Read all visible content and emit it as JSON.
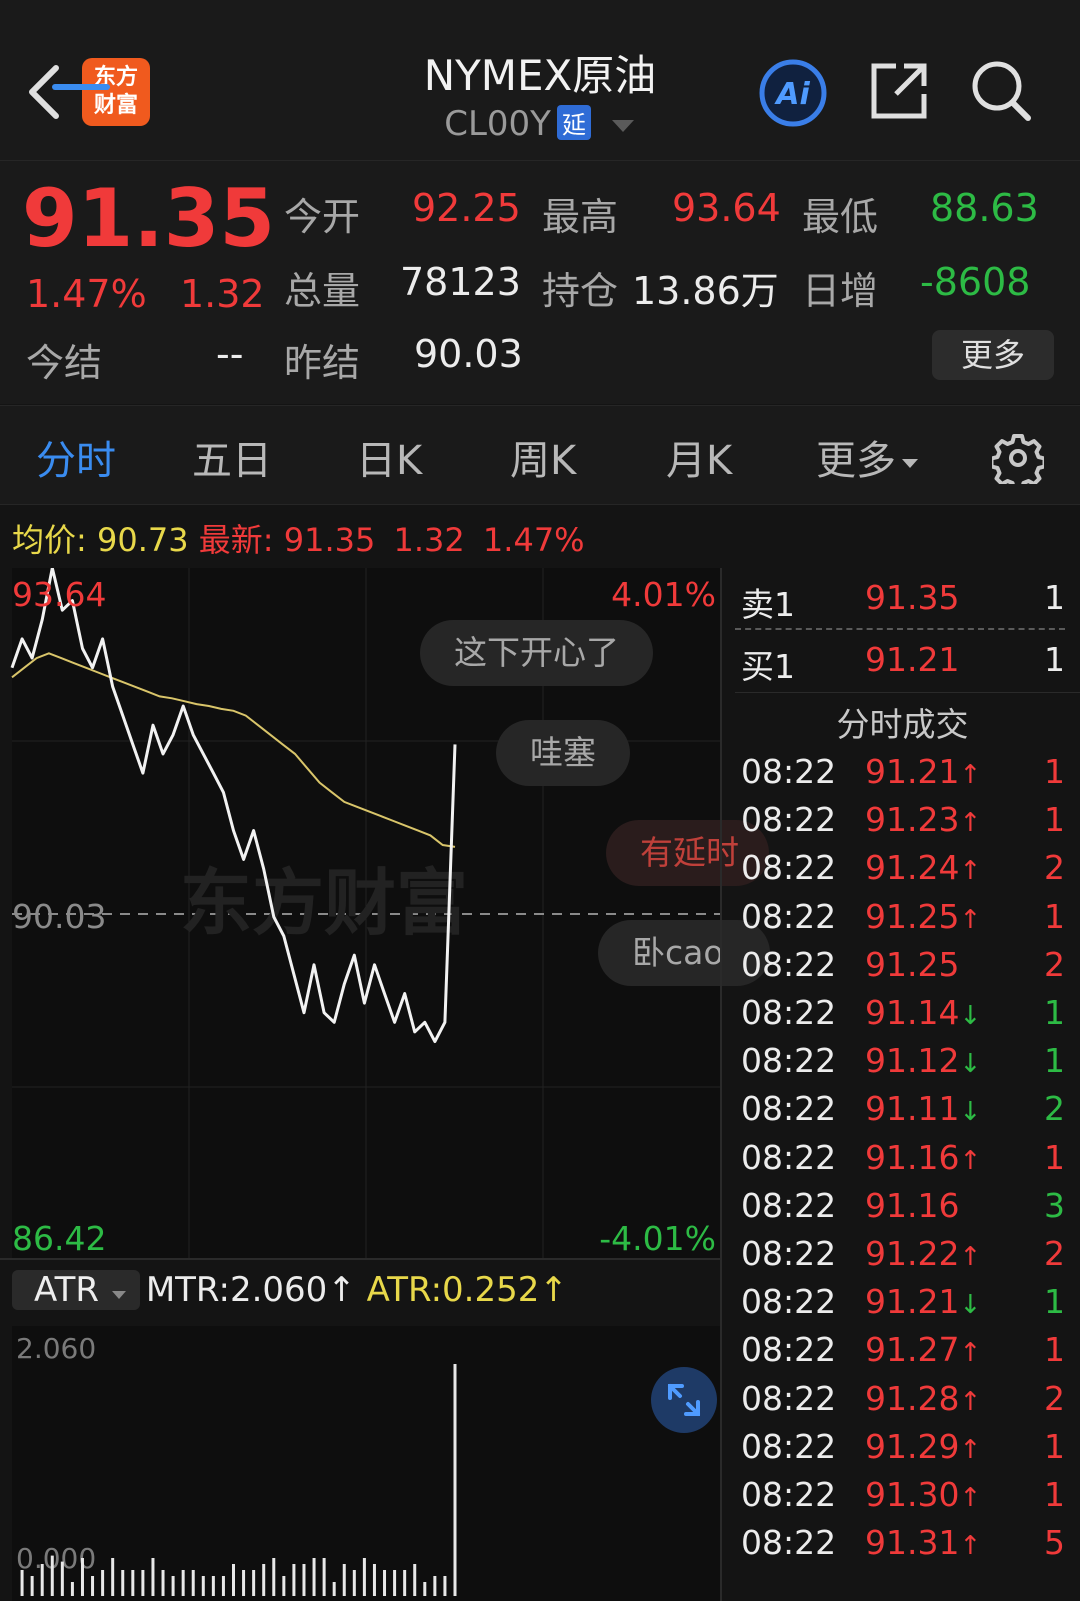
{
  "header": {
    "title": "NYMEX原油",
    "subtitle": "CL00Y",
    "delay_badge": "延",
    "logo_line1": "东方",
    "logo_line2": "财富"
  },
  "quote": {
    "price": "91.35",
    "change_pct": "1.47%",
    "change_abs": "1.32",
    "today_settle_label": "今结",
    "today_settle_value": "--",
    "open_label": "今开",
    "open_value": "92.25",
    "high_label": "最高",
    "high_value": "93.64",
    "low_label": "最低",
    "low_value": "88.63",
    "volume_label": "总量",
    "volume_value": "78123",
    "oi_label": "持仓",
    "oi_value": "13.86万",
    "daily_inc_label": "日增",
    "daily_inc_value": "-8608",
    "prev_settle_label": "昨结",
    "prev_settle_value": "90.03",
    "more_label": "更多"
  },
  "tabs": [
    "分时",
    "五日",
    "日K",
    "周K",
    "月K",
    "更多"
  ],
  "info_line": {
    "avg_label": "均价:",
    "avg_value": "90.73",
    "latest_label": "最新:",
    "latest_value": "91.35",
    "latest_change": "1.32",
    "latest_pct": "1.47%"
  },
  "chart_data": {
    "type": "line",
    "ymax_label": "93.64",
    "ymid_label": "90.03",
    "ymin_label": "86.42",
    "pct_max_label": "4.01%",
    "pct_min_label": "-4.01%",
    "ylim": [
      86.42,
      93.64
    ],
    "reference_price": 90.03,
    "price_series": [
      92.6,
      92.9,
      92.7,
      93.1,
      93.64,
      93.2,
      93.3,
      92.8,
      92.6,
      92.9,
      92.4,
      92.1,
      91.8,
      91.5,
      92.0,
      91.7,
      91.9,
      92.2,
      91.9,
      91.7,
      91.5,
      91.3,
      90.9,
      90.6,
      90.9,
      90.5,
      90.0,
      89.8,
      89.4,
      89.0,
      89.5,
      89.0,
      88.9,
      89.3,
      89.6,
      89.1,
      89.5,
      89.2,
      88.9,
      89.2,
      88.8,
      88.9,
      88.7,
      88.9,
      91.8
    ],
    "avg_series": [
      92.5,
      92.6,
      92.7,
      92.75,
      92.7,
      92.65,
      92.6,
      92.55,
      92.5,
      92.45,
      92.4,
      92.35,
      92.3,
      92.28,
      92.25,
      92.22,
      92.2,
      92.17,
      92.15,
      92.1,
      92.0,
      91.9,
      91.8,
      91.7,
      91.55,
      91.4,
      91.3,
      91.2,
      91.15,
      91.1,
      91.05,
      91.0,
      90.95,
      90.9,
      90.85,
      90.75,
      90.73
    ],
    "atr": {
      "indicator": "ATR",
      "mtr_label": "MTR:2.060",
      "atr_label": "ATR:0.252",
      "top_label": "2.060",
      "bottom_label": "0.000"
    }
  },
  "bubbles": [
    "这下开心了",
    "哇塞",
    "有延时",
    "卧cao"
  ],
  "depth": {
    "sell_label": "卖1",
    "sell_price": "91.35",
    "sell_vol": "1",
    "buy_label": "买1",
    "buy_price": "91.21",
    "buy_vol": "1",
    "trades_title": "分时成交",
    "trades": [
      {
        "time": "08:22",
        "price": "91.21",
        "arrow": "up",
        "vol": "1",
        "vol_color": "red"
      },
      {
        "time": "08:22",
        "price": "91.23",
        "arrow": "up",
        "vol": "1",
        "vol_color": "red"
      },
      {
        "time": "08:22",
        "price": "91.24",
        "arrow": "up",
        "vol": "2",
        "vol_color": "red"
      },
      {
        "time": "08:22",
        "price": "91.25",
        "arrow": "up",
        "vol": "1",
        "vol_color": "red"
      },
      {
        "time": "08:22",
        "price": "91.25",
        "arrow": "",
        "vol": "2",
        "vol_color": "red"
      },
      {
        "time": "08:22",
        "price": "91.14",
        "arrow": "down",
        "vol": "1",
        "vol_color": "green"
      },
      {
        "time": "08:22",
        "price": "91.12",
        "arrow": "down",
        "vol": "1",
        "vol_color": "green"
      },
      {
        "time": "08:22",
        "price": "91.11",
        "arrow": "down",
        "vol": "2",
        "vol_color": "green"
      },
      {
        "time": "08:22",
        "price": "91.16",
        "arrow": "up",
        "vol": "1",
        "vol_color": "red"
      },
      {
        "time": "08:22",
        "price": "91.16",
        "arrow": "",
        "vol": "3",
        "vol_color": "green"
      },
      {
        "time": "08:22",
        "price": "91.22",
        "arrow": "up",
        "vol": "2",
        "vol_color": "red"
      },
      {
        "time": "08:22",
        "price": "91.21",
        "arrow": "down",
        "vol": "1",
        "vol_color": "green"
      },
      {
        "time": "08:22",
        "price": "91.27",
        "arrow": "up",
        "vol": "1",
        "vol_color": "red"
      },
      {
        "time": "08:22",
        "price": "91.28",
        "arrow": "up",
        "vol": "2",
        "vol_color": "red"
      },
      {
        "time": "08:22",
        "price": "91.29",
        "arrow": "up",
        "vol": "1",
        "vol_color": "red"
      },
      {
        "time": "08:22",
        "price": "91.30",
        "arrow": "up",
        "vol": "1",
        "vol_color": "red"
      },
      {
        "time": "08:22",
        "price": "91.31",
        "arrow": "up",
        "vol": "5",
        "vol_color": "red"
      }
    ]
  },
  "colors": {
    "up": "#f03a3a",
    "down": "#2dbb45",
    "accent": "#3a8cf0",
    "avg_line": "#d9c56a"
  }
}
